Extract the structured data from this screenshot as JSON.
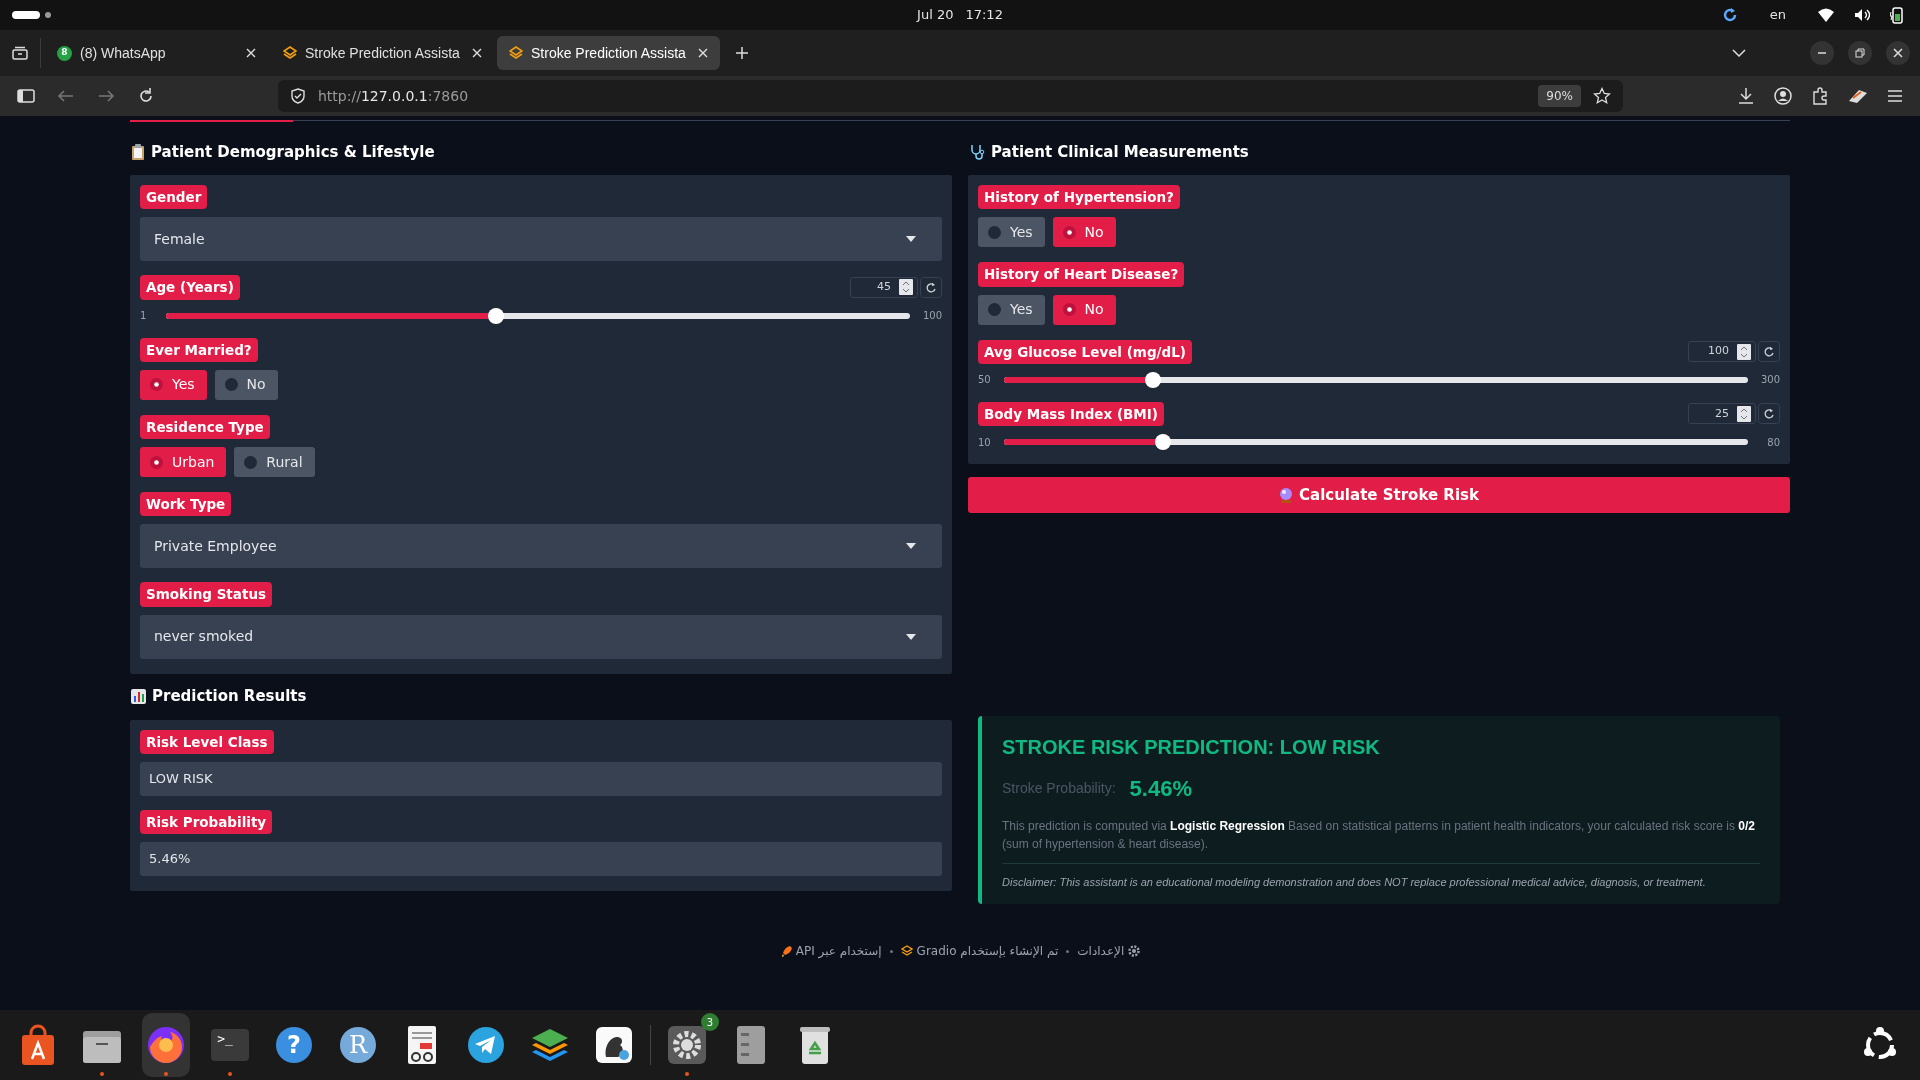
{
  "system_bar": {
    "date": "Jul 20",
    "time": "17:12",
    "language": "en"
  },
  "browser": {
    "tabs": [
      {
        "title": "(8) WhatsApp",
        "badge": "8",
        "kind": "chat",
        "selected": false
      },
      {
        "title": "Stroke Prediction Assista",
        "kind": "app",
        "selected": false
      },
      {
        "title": "Stroke Prediction Assista",
        "kind": "app",
        "selected": true
      }
    ],
    "address": {
      "scheme": "http://",
      "host": "127.0.0.1",
      "port": ":7860"
    },
    "zoom": "90%"
  },
  "demographics": {
    "title": "Patient Demographics & Lifestyle",
    "fields": [
      {
        "kind": "dropdown",
        "label": "Gender",
        "value": "Female"
      },
      {
        "kind": "slider",
        "label": "Age (Years)",
        "value": "45",
        "min": "1",
        "max": "100",
        "level": 0.444
      },
      {
        "kind": "radio",
        "label": "Ever Married?",
        "options": [
          {
            "label": "Yes",
            "selected": true
          },
          {
            "label": "No",
            "selected": false
          }
        ]
      },
      {
        "kind": "radio",
        "label": "Residence Type",
        "options": [
          {
            "label": "Urban",
            "selected": true
          },
          {
            "label": "Rural",
            "selected": false
          }
        ]
      },
      {
        "kind": "dropdown",
        "label": "Work Type",
        "value": "Private Employee"
      },
      {
        "kind": "dropdown",
        "label": "Smoking Status",
        "value": "never smoked"
      }
    ]
  },
  "clinical": {
    "title": "Patient Clinical Measurements",
    "fields": [
      {
        "kind": "radio",
        "label": "History of Hypertension?",
        "options": [
          {
            "label": "Yes",
            "selected": false
          },
          {
            "label": "No",
            "selected": true
          }
        ]
      },
      {
        "kind": "radio",
        "label": "History of Heart Disease?",
        "options": [
          {
            "label": "Yes",
            "selected": false
          },
          {
            "label": "No",
            "selected": true
          }
        ]
      },
      {
        "kind": "slider",
        "label": "Avg Glucose Level (mg/dL)",
        "value": "100",
        "min": "50",
        "max": "300",
        "level": 0.2
      },
      {
        "kind": "slider",
        "label": "Body Mass Index (BMI)",
        "value": "25",
        "min": "10",
        "max": "80",
        "level": 0.214
      }
    ],
    "button": "Calculate Stroke Risk"
  },
  "results": {
    "title": "Prediction Results",
    "fields": [
      {
        "kind": "textbox",
        "label": "Risk Level Class",
        "value": "LOW RISK"
      },
      {
        "kind": "textbox",
        "label": "Risk Probability",
        "value": "5.46%"
      }
    ]
  },
  "result_card": {
    "title": "STROKE RISK PREDICTION: LOW RISK",
    "probability_label": "Stroke Probability:",
    "probability": "5.46%",
    "description": "This prediction is computed via **Logistic Regression**  Based on statistical patterns in patient health indicators, your calculated risk score is **0/2** (sum of hypertension & heart disease).",
    "disclaimer": "Disclaimer: This assistant is an educational modeling demonstration and does NOT replace professional medical advice, diagnosis, or treatment."
  },
  "footer": [
    {
      "kind": "settings",
      "label": "الإعدادات"
    },
    {
      "kind": "gradio",
      "label": "تم الإنشاء بإستخدام Gradio"
    },
    {
      "kind": "api",
      "label": "إستخدام عبر API"
    }
  ],
  "dock": [
    {
      "kind": "store",
      "running": false
    },
    {
      "kind": "files",
      "running": true
    },
    {
      "kind": "firefox",
      "running": true
    },
    {
      "kind": "terminal",
      "glyph": ">_",
      "running": true
    },
    {
      "kind": "help",
      "glyph": "?",
      "running": false
    },
    {
      "kind": "rstudio",
      "glyph": "R",
      "running": false
    },
    {
      "kind": "reader",
      "running": false
    },
    {
      "kind": "telegram",
      "running": false
    },
    {
      "kind": "layers",
      "running": false
    },
    {
      "kind": "app",
      "running": false
    },
    {
      "kind": "settings",
      "badge": "3",
      "running": true
    },
    {
      "kind": "cabinet",
      "running": false
    },
    {
      "kind": "trash",
      "running": false
    }
  ]
}
